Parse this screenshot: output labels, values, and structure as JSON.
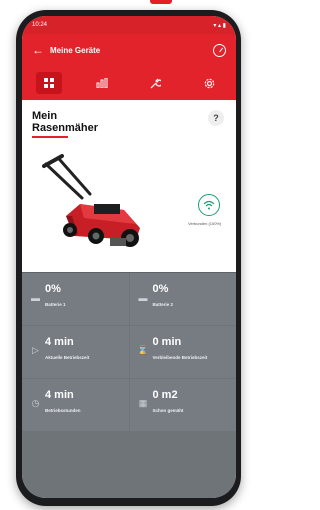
{
  "app": {
    "title": "Meine Geräte",
    "status_time": "10:24"
  },
  "tabs": [
    {
      "icon": "grid-icon",
      "active": true
    },
    {
      "icon": "chart-icon",
      "active": false
    },
    {
      "icon": "wrench-icon",
      "active": false
    },
    {
      "icon": "gear-icon",
      "active": false
    }
  ],
  "device": {
    "name_line1": "Mein",
    "name_line2": "Rasenmäher",
    "help": "?",
    "connection": "Verbunden (100%)"
  },
  "stats": [
    {
      "icon": "battery-icon",
      "value": "0%",
      "label": "Batterie 1"
    },
    {
      "icon": "battery-icon",
      "value": "0%",
      "label": "Batterie 2"
    },
    {
      "icon": "play-icon",
      "value": "4 min",
      "label": "Aktuelle Betriebszeit"
    },
    {
      "icon": "hourglass-icon",
      "value": "0 min",
      "label": "Verbleibende Betriebszeit"
    },
    {
      "icon": "clock-icon",
      "value": "4 min",
      "label": "Betriebsstunden"
    },
    {
      "icon": "map-icon",
      "value": "0 m2",
      "label": "Schon gemäht"
    }
  ],
  "colors": {
    "brand_red": "#e3232c",
    "tile_gray": "#777c82",
    "wifi_green": "#1a9e6f"
  }
}
